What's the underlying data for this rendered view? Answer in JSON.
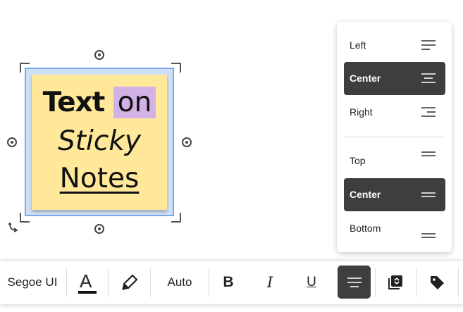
{
  "note": {
    "word_text": "Text",
    "word_on": "on",
    "line2": "Sticky",
    "line3": "Notes",
    "note_color": "#ffe89a",
    "highlight_color": "#d2b1e6"
  },
  "align_menu": {
    "horizontal": [
      {
        "label": "Left",
        "icon": "align-left-icon",
        "selected": false
      },
      {
        "label": "Center",
        "icon": "align-center-icon",
        "selected": true
      },
      {
        "label": "Right",
        "icon": "align-right-icon",
        "selected": false
      }
    ],
    "vertical": [
      {
        "label": "Top",
        "icon": "valign-top-icon",
        "selected": false
      },
      {
        "label": "Center",
        "icon": "valign-center-icon",
        "selected": true
      },
      {
        "label": "Bottom",
        "icon": "valign-bottom-icon",
        "selected": false
      }
    ]
  },
  "toolbar": {
    "font_name": "Segoe UI",
    "font_color_label": "A",
    "font_size": "Auto",
    "bold_label": "B",
    "italic_label": "I",
    "underline_label": "U",
    "accent_color": "#3e3e40"
  }
}
